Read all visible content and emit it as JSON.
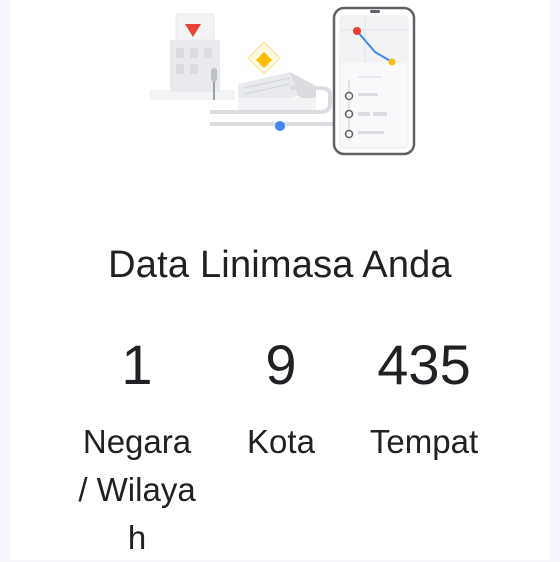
{
  "title": "Data Linimasa Anda",
  "stats": [
    {
      "value": "1",
      "label": "Negara / Wilayah"
    },
    {
      "value": "9",
      "label": "Kota"
    },
    {
      "value": "435",
      "label": "Tempat"
    }
  ],
  "colors": {
    "route_start": "#e94235",
    "route_end": "#fbbc04",
    "route_dot": "#4285f4",
    "marker": "#e94235",
    "diamond": "#fbbc04"
  },
  "icons": [
    "map-marker-icon",
    "diamond-icon",
    "phone-timeline-icon"
  ]
}
